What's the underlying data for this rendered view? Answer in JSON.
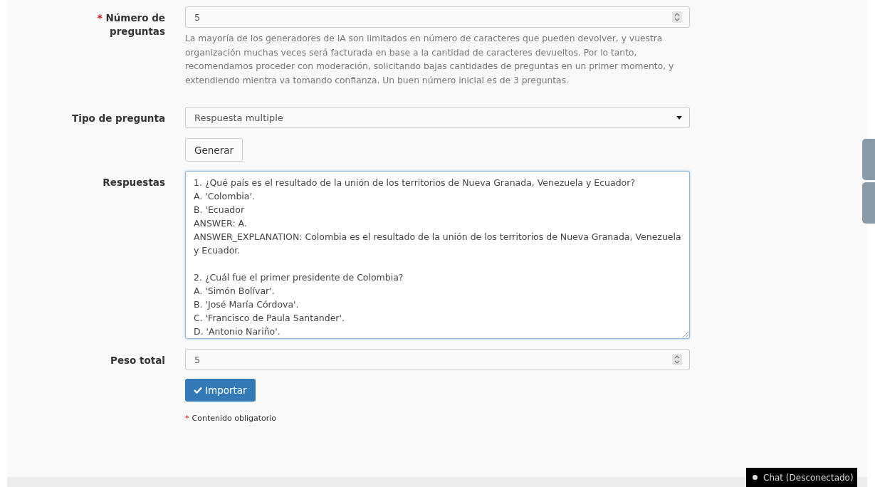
{
  "form": {
    "rows": [
      {
        "kind": "number",
        "label": "Número de preguntas",
        "required": true,
        "value": "5",
        "help": "La mayoría de los generadores de IA son limitados en número de caracteres que pueden devolver, y vuestra organización muchas veces será facturada en base a la cantidad de caracteres devueltos. Por lo tanto, recomendamos proceder con moderación, solicitando bajas cantidades de preguntas en un primer momento, y extendiendo mientra va tomando confianza. Un buen número inicial es de 3 preguntas."
      },
      {
        "kind": "select",
        "label": "Tipo de pregunta",
        "required": false,
        "value": "Respuesta multiple"
      },
      {
        "kind": "button",
        "label": "Generar"
      },
      {
        "kind": "textarea",
        "label": "Respuestas",
        "required": false,
        "focused": true,
        "paragraphs": [
          [
            "1. ¿Qué país es el resultado de la unión de los territorios de Nueva Granada, Venezuela y Ecuador?",
            "A. 'Colombia'.",
            "B. 'Ecuador",
            "ANSWER: A.",
            "ANSWER_EXPLANATION: Colombia es el resultado de la unión de los territorios de Nueva Granada, Venezuela y Ecuador."
          ],
          [
            "2. ¿Cuál fue el primer presidente de Colombia?",
            "A. 'Simón Bolívar'.",
            "B. 'José María Córdova'.",
            "C. 'Francisco de Paula Santander'.",
            "D. 'Antonio Nariño'."
          ]
        ]
      },
      {
        "kind": "number",
        "label": "Peso total",
        "required": false,
        "value": "5"
      },
      {
        "kind": "primary",
        "label": "Importar"
      }
    ],
    "required_note": {
      "mark": "*",
      "text": "Contenido obligatorio"
    }
  },
  "chat": {
    "label": "Chat (Desconectado)",
    "online": false
  }
}
